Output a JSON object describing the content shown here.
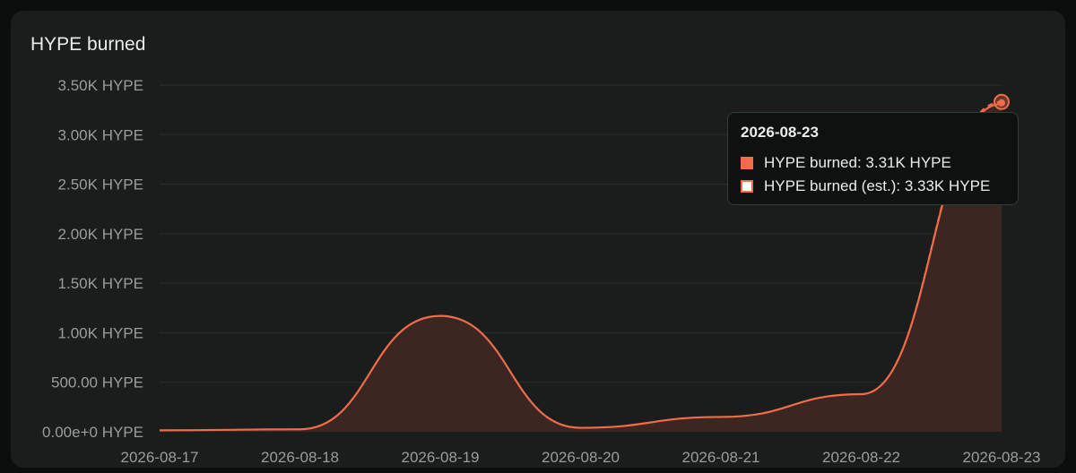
{
  "chart_title": "HYPE burned",
  "colors": {
    "line": "#f06c4a",
    "area": "#3d2723",
    "grid": "#2d2f2e",
    "est_swatch": "#ffffff"
  },
  "tooltip": {
    "date": "2026-08-23",
    "rows": [
      {
        "label": "HYPE burned: 3.31K HYPE",
        "swatch": "filled"
      },
      {
        "label": "HYPE burned (est.): 3.33K HYPE",
        "swatch": "outline"
      }
    ]
  },
  "chart_data": {
    "type": "area",
    "title": "HYPE burned",
    "x": [
      "2026-08-17",
      "2026-08-18",
      "2026-08-19",
      "2026-08-20",
      "2026-08-21",
      "2026-08-22",
      "2026-08-23"
    ],
    "y_ticks": [
      "0.00e+0 HYPE",
      "500.00 HYPE",
      "1.00K HYPE",
      "1.50K HYPE",
      "2.00K HYPE",
      "2.50K HYPE",
      "3.00K HYPE",
      "3.50K HYPE"
    ],
    "ylim": [
      0,
      3500
    ],
    "grid": true,
    "series": [
      {
        "name": "HYPE burned",
        "values": [
          15,
          25,
          1170,
          40,
          150,
          380,
          3310
        ],
        "style": "solid"
      },
      {
        "name": "HYPE burned (est.)",
        "values": [
          null,
          null,
          null,
          null,
          null,
          380,
          3330
        ],
        "style": "dashed"
      }
    ]
  }
}
